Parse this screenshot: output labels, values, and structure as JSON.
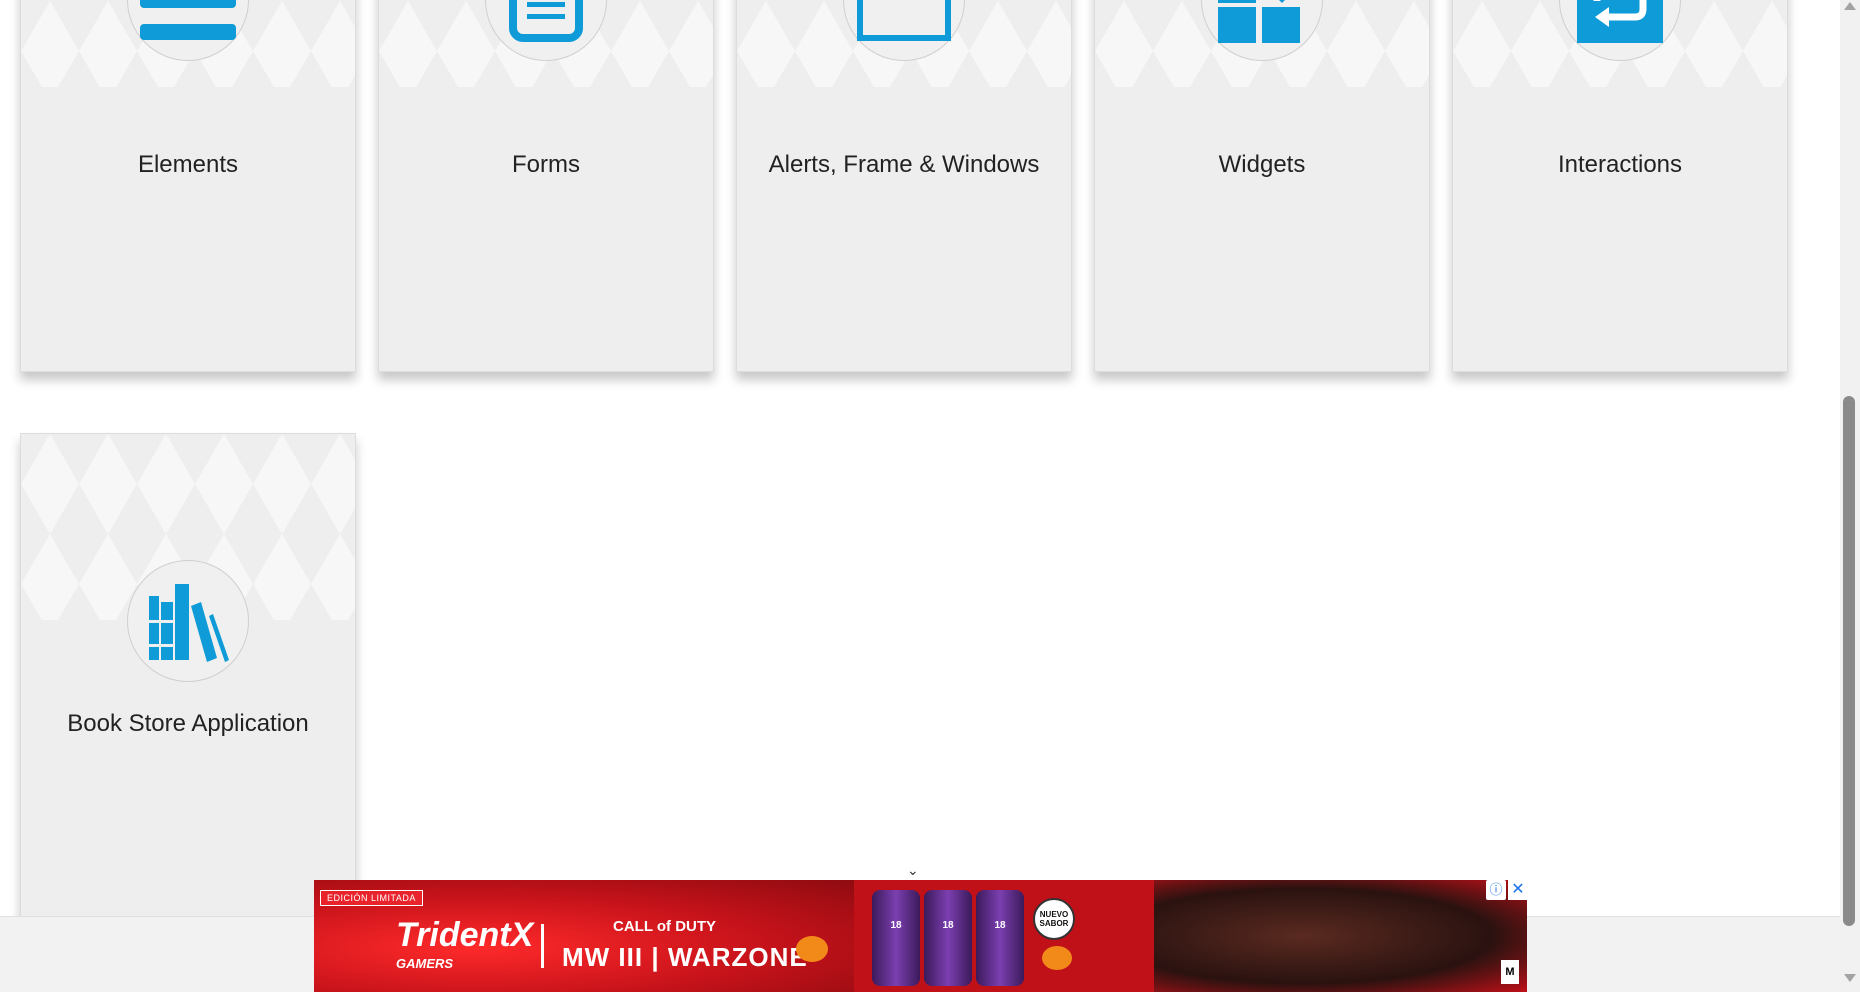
{
  "categories": [
    {
      "label": "Elements",
      "icon": "menu-icon"
    },
    {
      "label": "Forms",
      "icon": "document-icon"
    },
    {
      "label": "Alerts, Frame & Windows",
      "icon": "browser-window-icon"
    },
    {
      "label": "Widgets",
      "icon": "widgets-icon"
    },
    {
      "label": "Interactions",
      "icon": "repeat-icon"
    },
    {
      "label": "Book Store Application",
      "icon": "books-icon"
    }
  ],
  "colors": {
    "icon": "#0e9bd8",
    "card": "#eeeeee"
  },
  "ad": {
    "badge": "EDICIÓN LIMITADA",
    "brand": "TridentX",
    "brand_sub": "GAMERS",
    "cod": "CALL of DUTY",
    "mw": "MW III | WARZONE",
    "can_num": "18",
    "stamp": "NUEVO SABOR",
    "rating": "M",
    "info": "ⓘ",
    "close": "✕",
    "collapse": "⌄"
  }
}
